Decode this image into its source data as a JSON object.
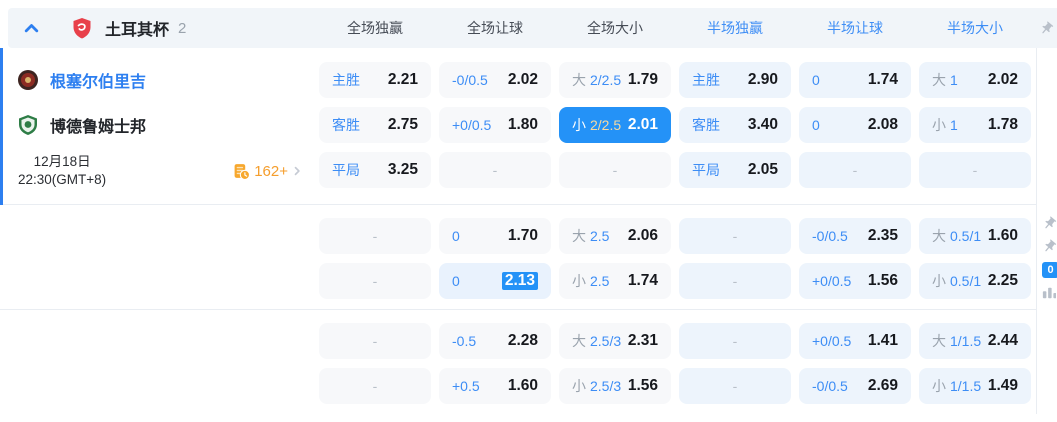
{
  "header": {
    "league": "土耳其杯",
    "count": "2",
    "columns": [
      {
        "label": "全场独赢",
        "scope": "full"
      },
      {
        "label": "全场让球",
        "scope": "full"
      },
      {
        "label": "全场大小",
        "scope": "full"
      },
      {
        "label": "半场独赢",
        "scope": "half"
      },
      {
        "label": "半场让球",
        "scope": "half"
      },
      {
        "label": "半场大小",
        "scope": "half"
      }
    ]
  },
  "match": {
    "home_team": "根塞尔伯里吉",
    "away_team": "博德鲁姆士邦",
    "date": "12月18日",
    "time": "22:30(GMT+8)",
    "markets_count": "162+"
  },
  "rail": {
    "badge": "0"
  },
  "icons": {
    "collapse": "chevron-up-icon",
    "league": "shield-logo",
    "pin": "pin-icon",
    "markets": "history-clock-icon",
    "more": "chevron-right-icon",
    "stats": "bars-icon"
  },
  "colors": {
    "accent_blue": "#2d7ff0",
    "selected_bg": "#2492f7",
    "label_blue": "#3d8df5",
    "gold": "#f6d9a1",
    "orange": "#f59e2d",
    "full_cell_bg": "#f7f8fa",
    "half_cell_bg": "#edf4fc"
  },
  "sections": [
    {
      "rows": [
        [
          {
            "label": "主胜",
            "value": "2.21"
          },
          {
            "label": "-0/0.5",
            "value": "2.02"
          },
          {
            "prefix": "大",
            "label": "2/2.5",
            "value": "1.79"
          },
          {
            "label": "主胜",
            "value": "2.90"
          },
          {
            "label": "0",
            "value": "1.74"
          },
          {
            "prefix": "大",
            "label": "1",
            "value": "2.02"
          }
        ],
        [
          {
            "label": "客胜",
            "value": "2.75"
          },
          {
            "label": "+0/0.5",
            "value": "1.80"
          },
          {
            "prefix": "小",
            "label": "2/2.5",
            "value": "2.01",
            "state": "selected"
          },
          {
            "label": "客胜",
            "value": "3.40"
          },
          {
            "label": "0",
            "value": "2.08"
          },
          {
            "prefix": "小",
            "label": "1",
            "value": "1.78"
          }
        ],
        [
          {
            "label": "平局",
            "value": "3.25"
          },
          {
            "dash": true
          },
          {
            "dash": true
          },
          {
            "label": "平局",
            "value": "2.05"
          },
          {
            "dash": true
          },
          {
            "dash": true
          }
        ]
      ]
    },
    {
      "rows": [
        [
          {
            "dash": true
          },
          {
            "label": "0",
            "value": "1.70"
          },
          {
            "prefix": "大",
            "label": "2.5",
            "value": "2.06"
          },
          {
            "dash": true
          },
          {
            "label": "-0/0.5",
            "value": "2.35"
          },
          {
            "prefix": "大",
            "label": "0.5/1",
            "value": "1.60"
          }
        ],
        [
          {
            "dash": true
          },
          {
            "label": "0",
            "value": "2.13",
            "state": "flash"
          },
          {
            "prefix": "小",
            "label": "2.5",
            "value": "1.74"
          },
          {
            "dash": true
          },
          {
            "label": "+0/0.5",
            "value": "1.56"
          },
          {
            "prefix": "小",
            "label": "0.5/1",
            "value": "2.25"
          }
        ]
      ]
    },
    {
      "rows": [
        [
          {
            "dash": true
          },
          {
            "label": "-0.5",
            "value": "2.28"
          },
          {
            "prefix": "大",
            "label": "2.5/3",
            "value": "2.31"
          },
          {
            "dash": true
          },
          {
            "label": "+0/0.5",
            "value": "1.41"
          },
          {
            "prefix": "大",
            "label": "1/1.5",
            "value": "2.44"
          }
        ],
        [
          {
            "dash": true
          },
          {
            "label": "+0.5",
            "value": "1.60"
          },
          {
            "prefix": "小",
            "label": "2.5/3",
            "value": "1.56"
          },
          {
            "dash": true
          },
          {
            "label": "-0/0.5",
            "value": "2.69"
          },
          {
            "prefix": "小",
            "label": "1/1.5",
            "value": "1.49"
          }
        ]
      ]
    }
  ]
}
